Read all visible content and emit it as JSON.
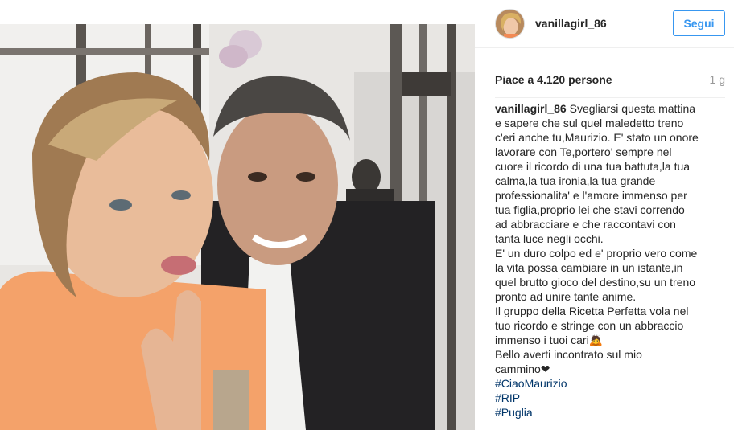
{
  "post": {
    "username": "vanillagirl_86",
    "follow_label": "Segui",
    "likes": "Piace a 4.120 persone",
    "time_ago": "1 g",
    "caption_first_line": "Svegliarsi questa mattina",
    "caption_lines": [
      "e sapere che sul quel maledetto treno",
      "c'eri anche tu,Maurizio. E' stato un onore",
      "lavorare con Te,portero' sempre nel",
      "cuore il ricordo di una tua battuta,la tua",
      "calma,la tua ironia,la tua grande",
      "professionalita' e l'amore immenso per",
      "tua figlia,proprio lei che stavi correndo",
      "ad abbracciare e che raccontavi con",
      "tanta luce negli occhi.",
      "E' un duro colpo ed e' proprio vero come",
      "la vita possa cambiare in un istante,in",
      "quel brutto gioco del destino,su un treno",
      "pronto ad unire tante anime.",
      "Il gruppo della Ricetta Perfetta vola nel",
      "tuo ricordo e stringe con un abbraccio",
      "immenso i tuoi cari🙇",
      "Bello averti incontrato sul mio",
      "cammino❤"
    ],
    "hashtags": [
      "#CiaoMaurizio",
      "#RIP",
      "#Puglia"
    ]
  },
  "colors": {
    "link": "#003569",
    "follow": "#3897f0",
    "muted": "#999999"
  }
}
